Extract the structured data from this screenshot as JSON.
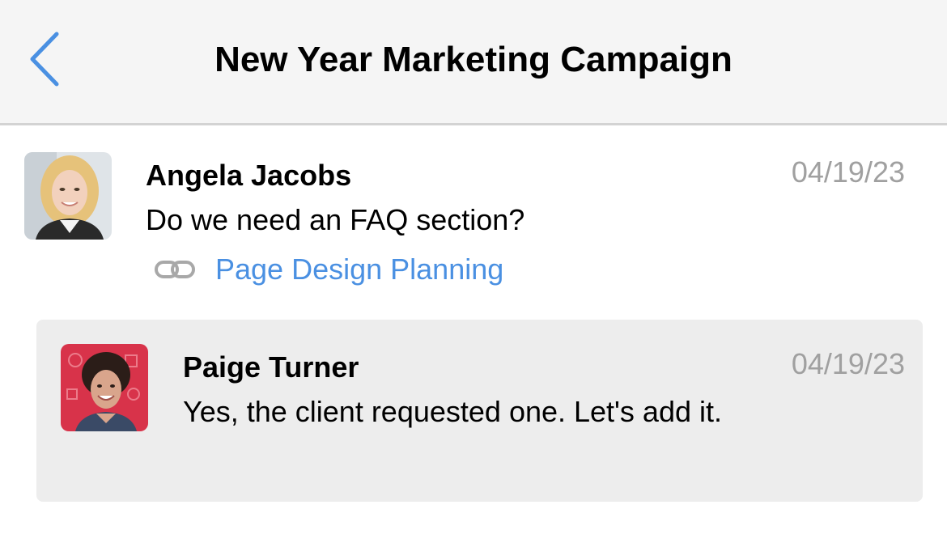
{
  "header": {
    "title": "New Year Marketing Campaign",
    "back_icon": "chevron-left-icon",
    "accent_color": "#4a90e2"
  },
  "comment": {
    "author": "Angela Jacobs",
    "date": "04/19/23",
    "text": "Do we need an FAQ section?",
    "link_icon": "link-icon",
    "link_label": "Page Design Planning"
  },
  "reply": {
    "author": "Paige Turner",
    "date": "04/19/23",
    "text": "Yes, the client requested one. Let's add it."
  }
}
